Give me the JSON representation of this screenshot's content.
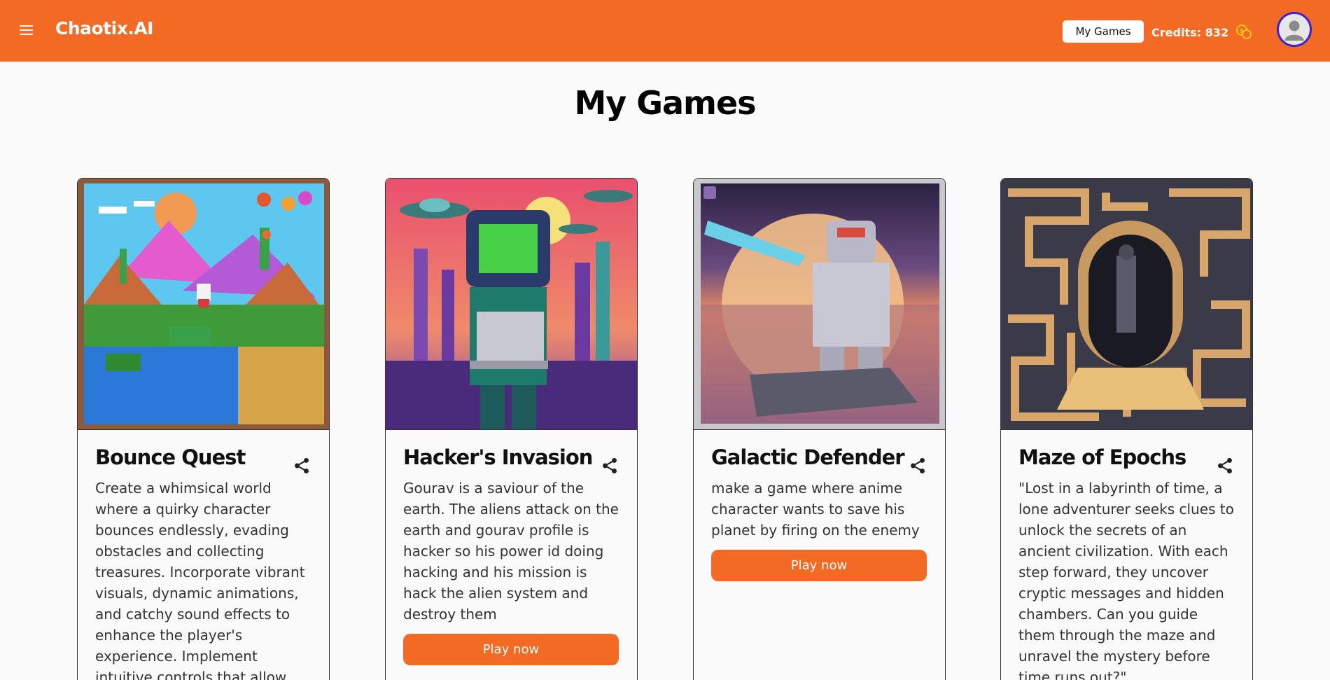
{
  "header": {
    "brand": "Chaotix.AI",
    "my_games_label": "My Games",
    "credits_label": "Credits: 832",
    "accent_color": "#f26a24"
  },
  "page": {
    "title": "My Games"
  },
  "games": [
    {
      "title": "Bounce Quest",
      "description": "Create a whimsical world where a quirky character bounces endlessly, evading obstacles and collecting treasures. Incorporate vibrant visuals, dynamic animations, and catchy sound effects to enhance the player's experience. Implement intuitive controls that allow",
      "image_icon": "pixel-landscape-image"
    },
    {
      "title": "Hacker's Invasion",
      "description": "Gourav is a saviour of the earth. The aliens attack on the earth and gourav profile is hacker so his power id doing hacking and his mission is hack the alien system and destroy them",
      "play_label": "Play now",
      "image_icon": "pixel-robot-hacker-image"
    },
    {
      "title": "Galactic Defender",
      "description": "make a game where anime character wants to save his planet by firing on the enemy",
      "play_label": "Play now",
      "image_icon": "pixel-armored-soldier-image"
    },
    {
      "title": "Maze of Epochs",
      "description": "\"Lost in a labyrinth of time, a lone adventurer seeks clues to unlock the secrets of an ancient civilization. With each step forward, they uncover cryptic messages and hidden chambers. Can you guide them through the maze and unravel the mystery before time runs out?\"",
      "image_icon": "pixel-maze-doorway-image"
    }
  ]
}
